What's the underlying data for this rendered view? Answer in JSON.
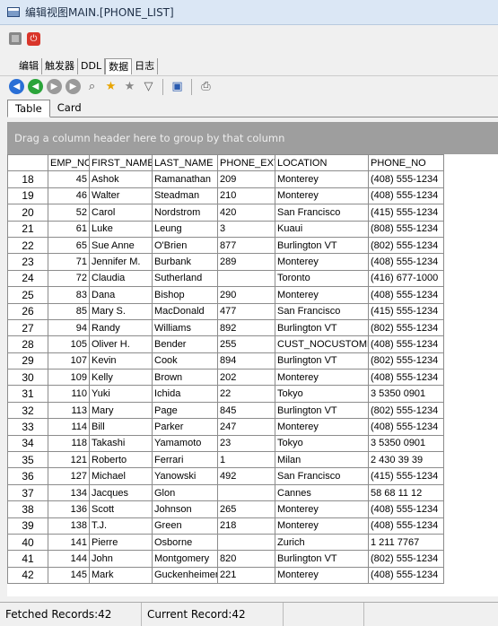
{
  "window": {
    "title": "编辑视图MAIN.[PHONE_LIST]"
  },
  "top_tabs": [
    "编辑",
    "触发器",
    "DDL",
    "数据",
    "日志"
  ],
  "top_tabs_active": 3,
  "toolbar": {
    "icons": [
      "first-record-icon",
      "prev-record-icon",
      "next-record-icon",
      "last-record-icon",
      "search-icon",
      "star-icon",
      "star-outline-icon",
      "filter-icon",
      "save-icon",
      "print-icon"
    ]
  },
  "view_tabs": [
    "Table",
    "Card"
  ],
  "group_panel": {
    "text": "Drag a column header here to group by that column"
  },
  "grid": {
    "columns": [
      "",
      "EMP_NO",
      "FIRST_NAME",
      "LAST_NAME",
      "PHONE_EXT",
      "LOCATION",
      "PHONE_NO"
    ],
    "rows": [
      [
        "18",
        "45",
        "Ashok",
        "Ramanathan",
        "209",
        "Monterey",
        "(408) 555-1234"
      ],
      [
        "19",
        "46",
        "Walter",
        "Steadman",
        "210",
        "Monterey",
        "(408) 555-1234"
      ],
      [
        "20",
        "52",
        "Carol",
        "Nordstrom",
        "420",
        "San Francisco",
        "(415) 555-1234"
      ],
      [
        "21",
        "61",
        "Luke",
        "Leung",
        "3",
        "Kuaui",
        "(808) 555-1234"
      ],
      [
        "22",
        "65",
        "Sue Anne",
        "O'Brien",
        "877",
        "Burlington VT",
        "(802) 555-1234"
      ],
      [
        "23",
        "71",
        "Jennifer M.",
        "Burbank",
        "289",
        "Monterey",
        "(408) 555-1234"
      ],
      [
        "24",
        "72",
        "Claudia",
        "Sutherland",
        "",
        "Toronto",
        "(416) 677-1000"
      ],
      [
        "25",
        "83",
        "Dana",
        "Bishop",
        "290",
        "Monterey",
        "(408) 555-1234"
      ],
      [
        "26",
        "85",
        "Mary S.",
        "MacDonald",
        "477",
        "San Francisco",
        "(415) 555-1234"
      ],
      [
        "27",
        "94",
        "Randy",
        "Williams",
        "892",
        "Burlington VT",
        "(802) 555-1234"
      ],
      [
        "28",
        "105",
        "Oliver H.",
        "Bender",
        "255",
        "CUST_NOCUSTOME",
        "(408) 555-1234"
      ],
      [
        "29",
        "107",
        "Kevin",
        "Cook",
        "894",
        "Burlington VT",
        "(802) 555-1234"
      ],
      [
        "30",
        "109",
        "Kelly",
        "Brown",
        "202",
        "Monterey",
        "(408) 555-1234"
      ],
      [
        "31",
        "110",
        "Yuki",
        "Ichida",
        "22",
        "Tokyo",
        "3 5350 0901"
      ],
      [
        "32",
        "113",
        "Mary",
        "Page",
        "845",
        "Burlington VT",
        "(802) 555-1234"
      ],
      [
        "33",
        "114",
        "Bill",
        "Parker",
        "247",
        "Monterey",
        "(408) 555-1234"
      ],
      [
        "34",
        "118",
        "Takashi",
        "Yamamoto",
        "23",
        "Tokyo",
        "3 5350 0901"
      ],
      [
        "35",
        "121",
        "Roberto",
        "Ferrari",
        "1",
        "Milan",
        "2 430 39 39"
      ],
      [
        "36",
        "127",
        "Michael",
        "Yanowski",
        "492",
        "San Francisco",
        "(415) 555-1234"
      ],
      [
        "37",
        "134",
        "Jacques",
        "Glon",
        "",
        "Cannes",
        "58 68 11 12"
      ],
      [
        "38",
        "136",
        "Scott",
        "Johnson",
        "265",
        "Monterey",
        "(408) 555-1234"
      ],
      [
        "39",
        "138",
        "T.J.",
        "Green",
        "218",
        "Monterey",
        "(408) 555-1234"
      ],
      [
        "40",
        "141",
        "Pierre",
        "Osborne",
        "",
        "Zurich",
        "1 211 7767"
      ],
      [
        "41",
        "144",
        "John",
        "Montgomery",
        "820",
        "Burlington VT",
        "(802) 555-1234"
      ],
      [
        "42",
        "145",
        "Mark",
        "Guckenheimer",
        "221",
        "Monterey",
        "(408) 555-1234"
      ]
    ]
  },
  "status": {
    "fetched": "Fetched Records:42",
    "current": "Current Record:42"
  }
}
